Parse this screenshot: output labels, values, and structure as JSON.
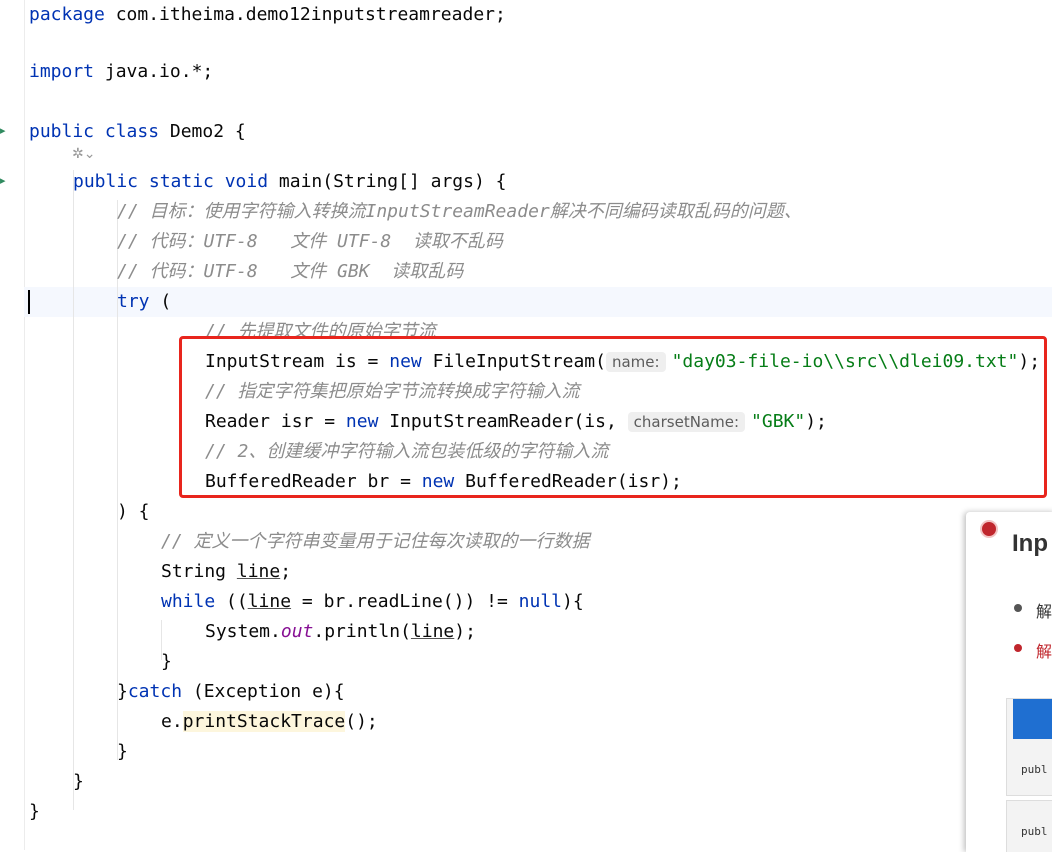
{
  "editor": {
    "lines": {
      "package_kw": "package",
      "package_name": " com.itheima.demo12inputstreamreader;",
      "import_kw": "import",
      "import_name": " java.io.*;",
      "class_kw": "public class",
      "class_name": " Demo2 {",
      "main_kw": "public static void",
      "main_sig": " main(String[] args) {",
      "c1": "// 目标：使用字符输入转换流InputStreamReader解决不同编码读取乱码的问题、",
      "c2": "// 代码：UTF-8   文件 UTF-8  读取不乱码",
      "c3": "// 代码：UTF-8   文件 GBK  读取乱码",
      "try_kw": "try",
      "try_rest": " (",
      "c4": "// 先提取文件的原始字节流",
      "l_is_pre": "InputStream is = ",
      "l_is_new": "new",
      "l_is_mid": " FileInputStream(",
      "l_is_hint": "name:",
      "l_is_str": "\"day03-file-io\\\\src\\\\dlei09.txt\"",
      "l_is_end": ");",
      "c5": "// 指定字符集把原始字节流转换成字符输入流",
      "l_isr_pre": "Reader isr = ",
      "l_isr_new": "new",
      "l_isr_mid": " InputStreamReader(is, ",
      "l_isr_hint": "charsetName:",
      "l_isr_str": "\"GBK\"",
      "l_isr_end": ");",
      "c6": "// 2、创建缓冲字符输入流包装低级的字符输入流",
      "l_br_pre": "BufferedReader br = ",
      "l_br_new": "new",
      "l_br_mid": " BufferedReader(isr);",
      "close_try": ") {",
      "c7": "// 定义一个字符串变量用于记住每次读取的一行数据",
      "l_str_pre": "String ",
      "l_str_var": "line",
      "l_str_end": ";",
      "while_kw": "while",
      "while_a": " ((",
      "while_var": "line",
      "while_b": " = br.readLine()) != ",
      "while_null": "null",
      "while_c": "){",
      "print_a": "System.",
      "print_out": "out",
      "print_b": ".println(",
      "print_var": "line",
      "print_c": ");",
      "brace1": "}",
      "catch_a": "}",
      "catch_kw": "catch",
      "catch_b": " (Exception e){",
      "trace_a": "e.",
      "trace_m": "printStackTrace",
      "trace_b": "();",
      "brace2": "}",
      "brace3": "}",
      "brace4": "}"
    },
    "ai_icon": "✲⌄"
  },
  "overlay_panel": {
    "title": "Inp",
    "bullet1": "解",
    "bullet2": "解",
    "code1": "publ",
    "code2": "publ",
    "accent": "#1f6fd1",
    "record_color": "#c0262d"
  },
  "highlight_box_color": "#e8251d"
}
